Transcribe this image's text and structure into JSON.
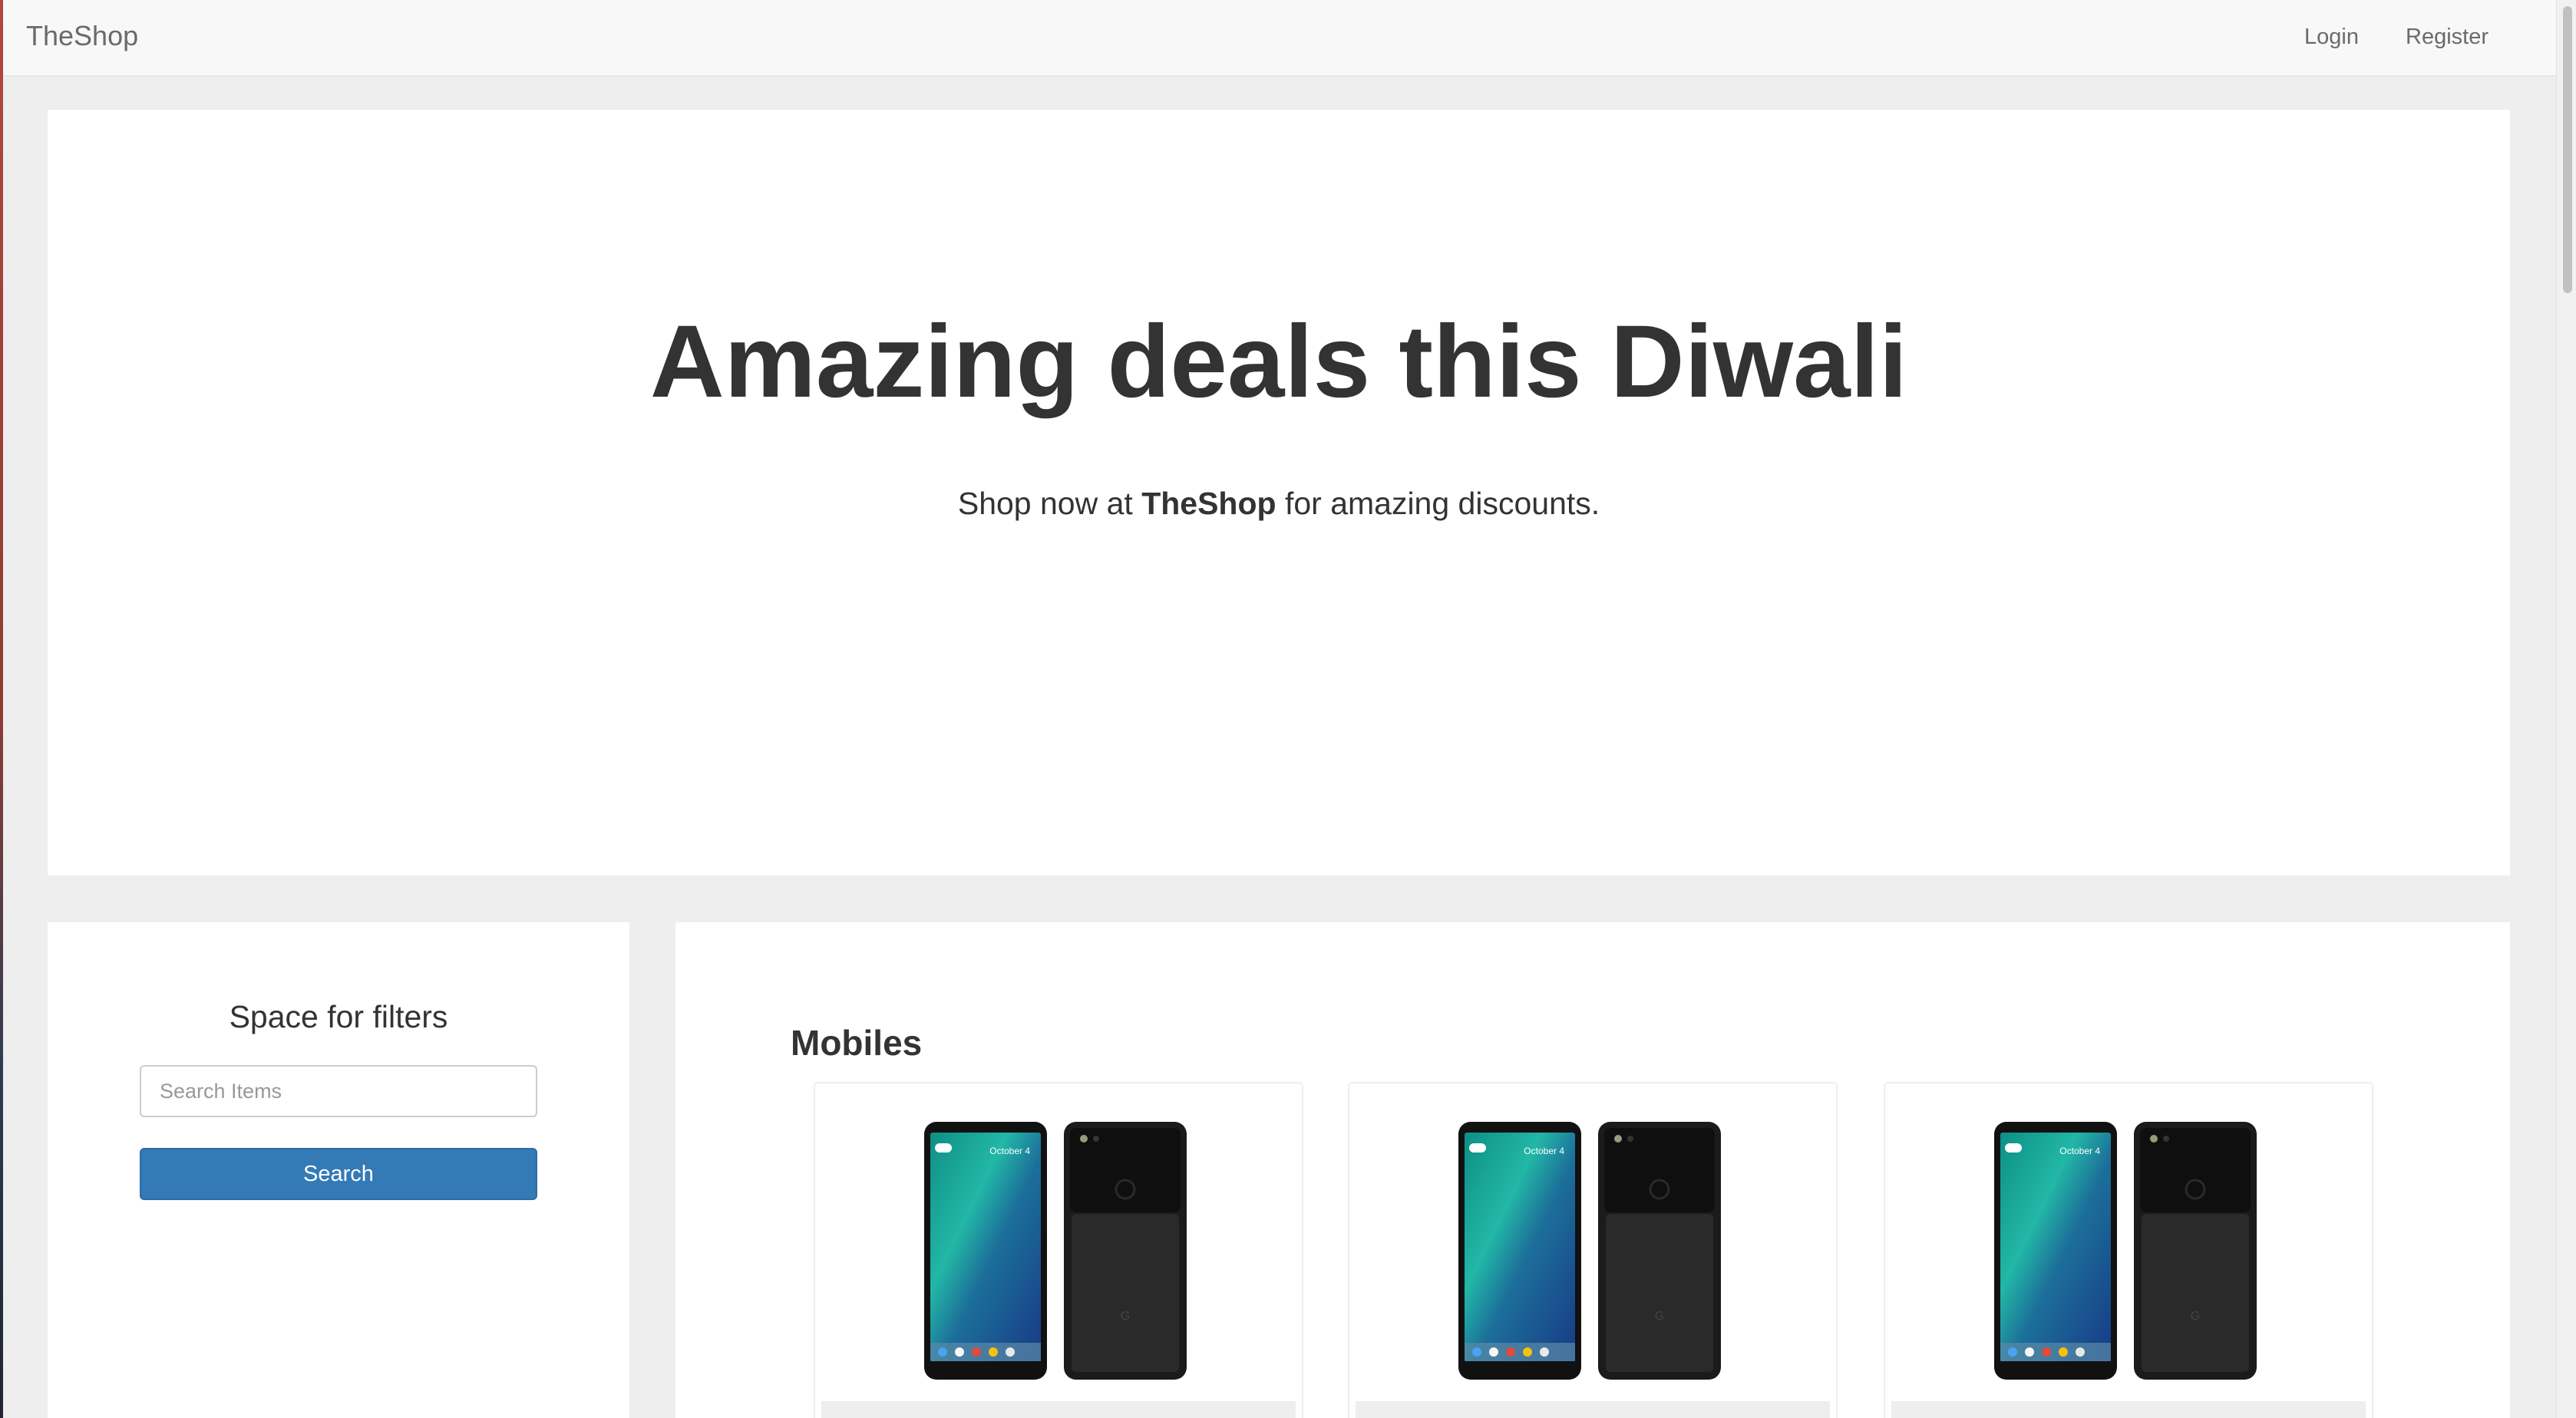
{
  "navbar": {
    "brand": "TheShop",
    "links": [
      "Login",
      "Register"
    ]
  },
  "hero": {
    "title": "Amazing deals this Diwali",
    "subtitle_prefix": "Shop now at ",
    "subtitle_brand": "TheShop",
    "subtitle_suffix": " for amazing discounts."
  },
  "filters": {
    "title": "Space for filters",
    "search_placeholder": "Search Items",
    "search_value": "",
    "search_button": "Search"
  },
  "products": {
    "section_title": "Mobiles",
    "items": [
      {
        "image": "phone-pair-image",
        "screen_text": "October 4"
      },
      {
        "image": "phone-pair-image",
        "screen_text": "October 4"
      },
      {
        "image": "phone-pair-image",
        "screen_text": "October 4"
      }
    ]
  },
  "colors": {
    "primary_button": "#337ab7",
    "navbar_bg": "#f8f8f8",
    "page_bg": "#eeeeee"
  }
}
